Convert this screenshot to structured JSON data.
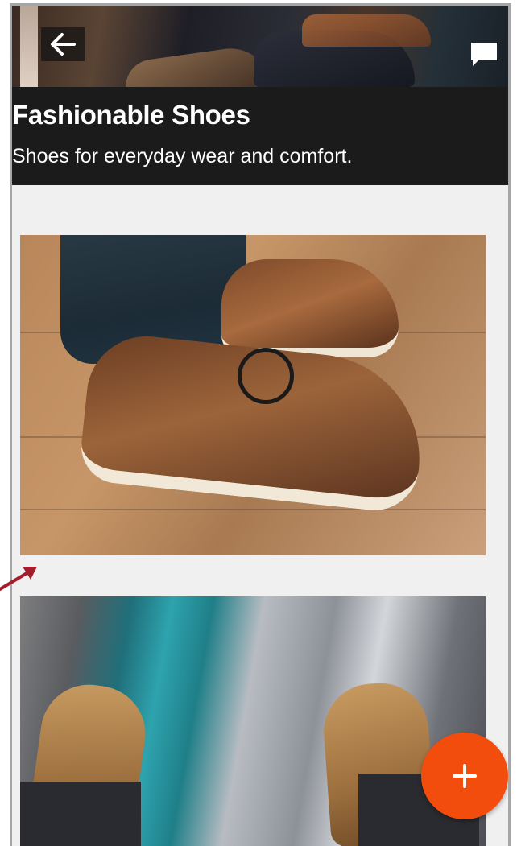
{
  "header": {
    "title": "Fashionable Shoes",
    "subtitle": "Shoes for everyday wear and comfort.",
    "back_icon": "arrow-left-icon",
    "chat_icon": "chat-bubble-icon"
  },
  "cards": [
    {
      "image": "brown-boat-shoes-on-wood-floor"
    },
    {
      "image": "boots-over-river-canyon"
    }
  ],
  "fab": {
    "label": "+",
    "icon": "plus-icon",
    "color": "#f24d0c"
  },
  "colors": {
    "title_bar": "#1b1b1b",
    "background": "#f0f0f0",
    "annotation_arrow": "#a51d2d"
  }
}
